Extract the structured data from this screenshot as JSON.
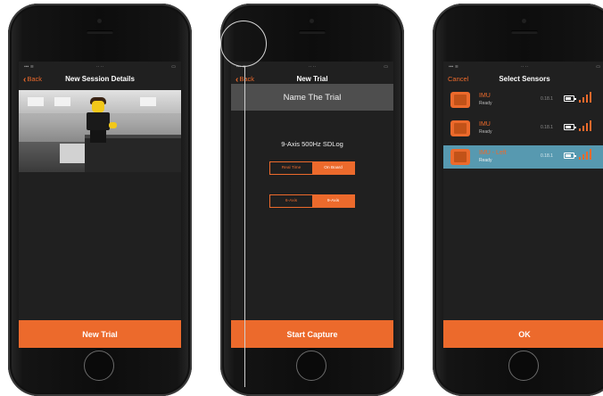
{
  "colors": {
    "accent": "#ec6a2c",
    "screen_bg": "#202020",
    "selected_row": "#5799b0",
    "header_gray": "#4e4e4e"
  },
  "phone1": {
    "back_label": "Back",
    "title": "New Session Details",
    "cta_label": "New Trial"
  },
  "phone2": {
    "back_label": "Back",
    "title": "New Trial",
    "header": "Name The Trial",
    "mode_label": "9-Axis 500Hz SDLog",
    "mode_options": [
      "Real Time",
      "On Board"
    ],
    "axis_options": [
      "6-Axis",
      "9-Axis"
    ],
    "cta_label": "Start Capture"
  },
  "phone3": {
    "cancel_label": "Cancel",
    "title": "Select Sensors",
    "sensors": [
      {
        "name": "IMU",
        "status": "Ready",
        "version": "0.18.1"
      },
      {
        "name": "IMU",
        "status": "Ready",
        "version": "0.18.1"
      },
      {
        "name": "IMU - Left",
        "status": "Ready",
        "version": "0.18.1"
      }
    ],
    "cta_label": "OK"
  }
}
